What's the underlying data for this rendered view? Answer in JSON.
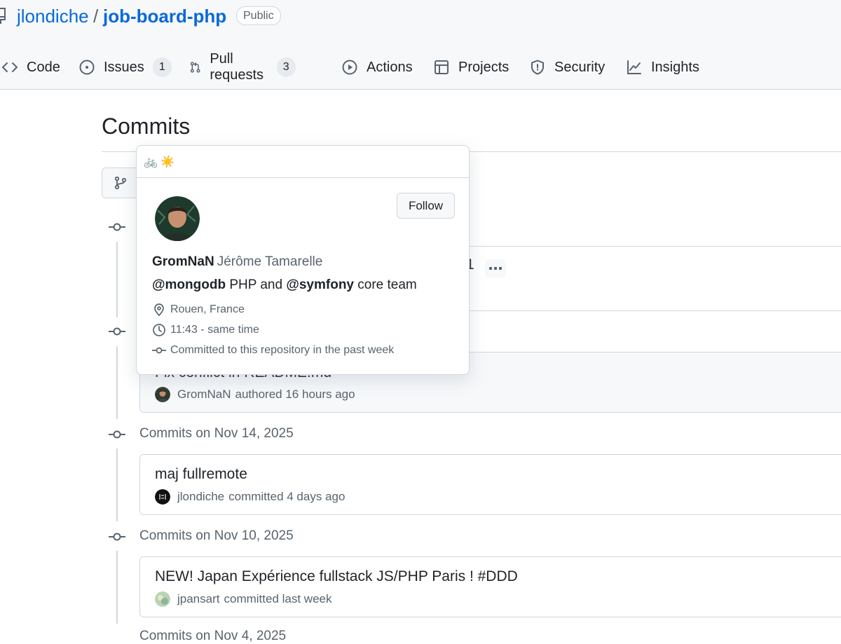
{
  "repo": {
    "owner": "jlondiche",
    "separator": "/",
    "name": "job-board-php",
    "visibility": "Public"
  },
  "nav": {
    "code": "Code",
    "issues": "Issues",
    "issues_count": "1",
    "pull_requests": "Pull requests",
    "pull_requests_count": "3",
    "actions": "Actions",
    "projects": "Projects",
    "security": "Security",
    "insights": "Insights"
  },
  "page": {
    "title": "Commits"
  },
  "commits": {
    "hidden_title_tail": "-1",
    "partial_message": "Fix conflict in README.md",
    "group2_author": "GromNaN",
    "group2_action": "authored 16 hours ago",
    "group3_label": "Commits on Nov 14, 2025",
    "group3_message": "maj fullremote",
    "group3_author": "jlondiche",
    "group3_action": "committed 4 days ago",
    "group4_label": "Commits on Nov 10, 2025",
    "group4_message": "NEW! Japan Expérience fullstack JS/PHP Paris ! #DDD",
    "group4_author": "jpansart",
    "group4_action": "committed last week",
    "group5_label": "Commits on Nov 4, 2025"
  },
  "hovercard": {
    "status_emoji": "🚲 ☀️",
    "follow_label": "Follow",
    "login": "GromNaN",
    "full_name": "Jérôme Tamarelle",
    "bio_mention1": "@mongodb",
    "bio_middle": " PHP and ",
    "bio_mention2": "@symfony",
    "bio_end": " core team",
    "location": "Rouen, France",
    "local_time": "11:43 - same time",
    "contribution": "Committed to this repository in the past week"
  },
  "colors": {
    "link": "#0969da",
    "muted": "#59636e",
    "border": "#d0d7de"
  }
}
